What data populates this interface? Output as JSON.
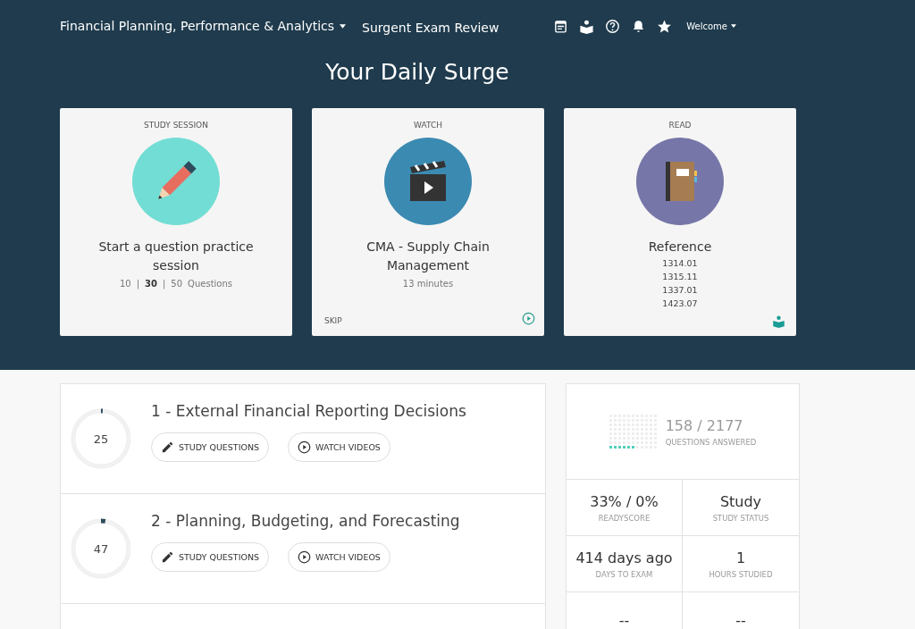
{
  "nav": {
    "course": "Financial Planning, Performance & Analytics",
    "brand": "Surgent Exam Review",
    "user": "Welcome"
  },
  "heading": "Your Daily Surge",
  "cards": [
    {
      "kind": "study",
      "label": "STUDY SESSION",
      "title": "Start a question practice session",
      "options": [
        {
          "label": "10",
          "selected": false
        },
        {
          "label": "30",
          "selected": true
        },
        {
          "label": "50",
          "selected": false
        }
      ],
      "separator": "|",
      "options_suffix": "Questions"
    },
    {
      "kind": "watch",
      "label": "WATCH",
      "title": "CMA - Supply Chain Management",
      "subtitle": "13 minutes",
      "footer": "SKIP"
    },
    {
      "kind": "read",
      "label": "READ",
      "title": "Reference",
      "lines": [
        "1314.01",
        "1315.11",
        "1337.01",
        "1423.07"
      ]
    }
  ],
  "sections": [
    {
      "number": "25",
      "level": 0.01,
      "title": "1 - External Financial Reporting Decisions",
      "buttons": [
        "STUDY QUESTIONS",
        "WATCH VIDEOS"
      ]
    },
    {
      "number": "47",
      "level": 0.025,
      "title": "2 - Planning, Budgeting, and Forecasting",
      "buttons": [
        "STUDY QUESTIONS",
        "WATCH VIDEOS"
      ]
    }
  ],
  "stats": {
    "answered": "158",
    "total": "2177",
    "separator": "/",
    "answered_label": "QUESTIONS ANSWERED",
    "tiles": [
      {
        "value": "33% / 0%",
        "label": "READYSCORE"
      },
      {
        "value": "Study",
        "label": "STUDY STATUS"
      },
      {
        "value": "414 days ago",
        "label": "DAYS TO EXAM"
      },
      {
        "value": "1",
        "label": "HOURS STUDIED"
      },
      {
        "value": "--"
      },
      {
        "value": "--"
      }
    ]
  }
}
